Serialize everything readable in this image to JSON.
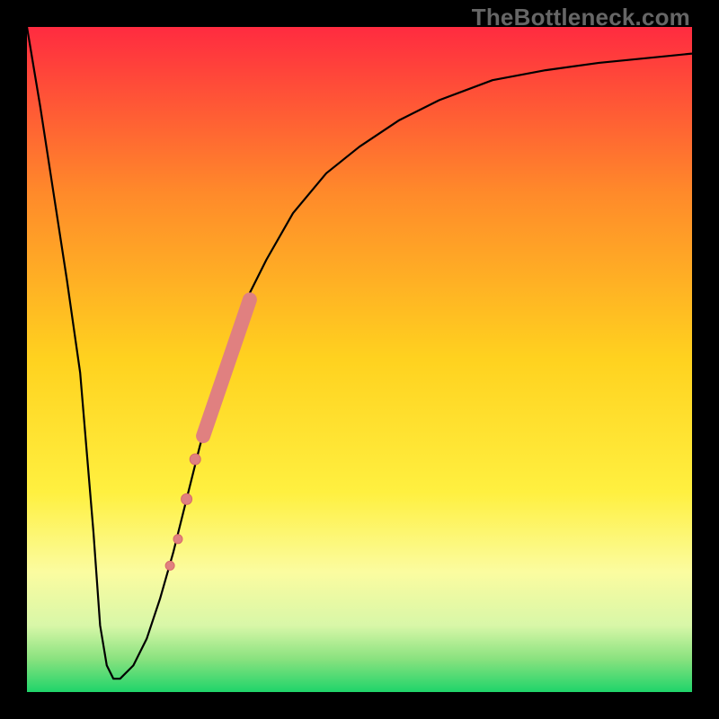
{
  "watermark": "TheBottleneck.com",
  "chart_data": {
    "type": "line",
    "title": "",
    "xlabel": "",
    "ylabel": "",
    "xlim": [
      0,
      100
    ],
    "ylim": [
      0,
      100
    ],
    "grid": false,
    "legend": false,
    "background_gradient_stops": [
      {
        "offset": 0.0,
        "color": "#ff2b40"
      },
      {
        "offset": 0.25,
        "color": "#ff8a2a"
      },
      {
        "offset": 0.5,
        "color": "#ffd21f"
      },
      {
        "offset": 0.7,
        "color": "#fff040"
      },
      {
        "offset": 0.82,
        "color": "#fbfca0"
      },
      {
        "offset": 0.9,
        "color": "#d8f7a8"
      },
      {
        "offset": 0.95,
        "color": "#8ae27f"
      },
      {
        "offset": 1.0,
        "color": "#1fd46a"
      }
    ],
    "series": [
      {
        "name": "bottleneck-curve",
        "color": "#000000",
        "width": 2.2,
        "x": [
          0,
          2,
          4,
          6,
          8,
          10,
          11,
          12,
          13,
          14,
          16,
          18,
          20,
          22,
          24,
          26,
          28,
          30,
          33,
          36,
          40,
          45,
          50,
          56,
          62,
          70,
          78,
          86,
          94,
          100
        ],
        "y": [
          100,
          88,
          75,
          62,
          48,
          24,
          10,
          4,
          2,
          2,
          4,
          8,
          14,
          21,
          29,
          37,
          44,
          51,
          59,
          65,
          72,
          78,
          82,
          86,
          89,
          92,
          93.5,
          94.6,
          95.4,
          96
        ]
      }
    ],
    "highlight_points": {
      "name": "highlight-dots",
      "color": "#e08080",
      "stroke": "#d86a6a",
      "points": [
        {
          "x": 21.5,
          "y": 19,
          "r": 5
        },
        {
          "x": 22.7,
          "y": 23,
          "r": 5
        },
        {
          "x": 24.0,
          "y": 29,
          "r": 6
        },
        {
          "x": 25.3,
          "y": 35,
          "r": 6
        }
      ]
    },
    "highlight_segment": {
      "name": "highlight-band",
      "color": "#e08080",
      "stroke": "#d86a6a",
      "width": 16,
      "x1": 26.5,
      "y1": 38.5,
      "x2": 33.5,
      "y2": 59.0
    }
  }
}
